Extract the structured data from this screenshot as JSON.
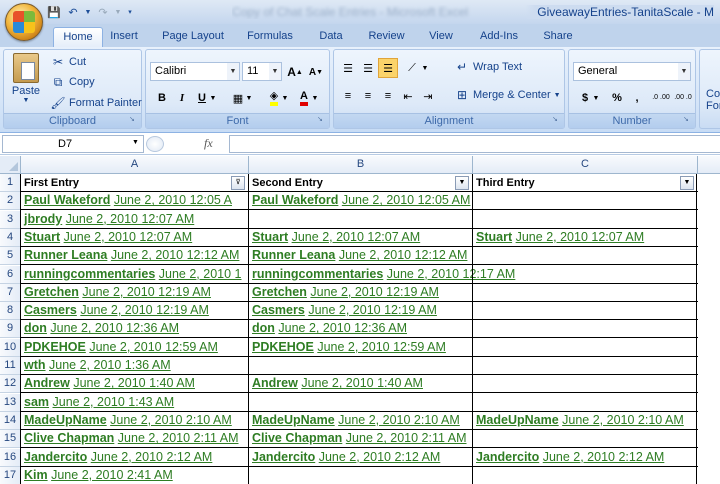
{
  "titlebar": {
    "title": "GiveawayEntries-TanitaScale - M",
    "blurred": "Copy of Chat Scale Entries - Microsoft Excel"
  },
  "tabs": [
    "Home",
    "Insert",
    "Page Layout",
    "Formulas",
    "Data",
    "Review",
    "View",
    "Add-Ins",
    "Share"
  ],
  "ribbon": {
    "clipboard": {
      "label": "Clipboard",
      "paste": "Paste",
      "cut": "Cut",
      "copy": "Copy",
      "format_painter": "Format Painter"
    },
    "font": {
      "label": "Font",
      "name": "Calibri",
      "size": "11",
      "bold": "B",
      "italic": "I",
      "underline": "U",
      "grow": "A",
      "shrink": "A",
      "font_color": "A"
    },
    "alignment": {
      "label": "Alignment",
      "wrap_text": "Wrap Text",
      "merge_center": "Merge & Center"
    },
    "number": {
      "label": "Number",
      "format": "General",
      "currency": "$",
      "percent": "%",
      "comma": ",",
      "inc_decimal": ".0 .00",
      "dec_decimal": ".00 .0"
    },
    "conditional": {
      "line1": "Co",
      "line2": "For"
    }
  },
  "formula_bar": {
    "name_box": "D7",
    "fx": "fx",
    "formula": ""
  },
  "columns": [
    "A",
    "B",
    "C"
  ],
  "header_row": {
    "a": "First Entry",
    "b": "Second Entry",
    "c": "Third Entry"
  },
  "rows": [
    {
      "num": "2",
      "a": {
        "name": "Paul Wakeford",
        "date": "June 2, 2010 12:05 A"
      },
      "b": {
        "name": "Paul Wakeford",
        "date": "June 2, 2010 12:05 AM"
      },
      "c": null
    },
    {
      "num": "3",
      "a": {
        "name": "jbrody",
        "date": "June 2, 2010 12:07 AM"
      },
      "b": null,
      "c": null
    },
    {
      "num": "4",
      "a": {
        "name": "Stuart",
        "date": "June 2, 2010 12:07 AM"
      },
      "b": {
        "name": "Stuart",
        "date": "June 2, 2010 12:07 AM"
      },
      "c": {
        "name": "Stuart",
        "date": "June 2, 2010 12:07 AM"
      }
    },
    {
      "num": "5",
      "a": {
        "name": "Runner Leana",
        "date": "June 2, 2010 12:12 AM"
      },
      "b": {
        "name": "Runner Leana",
        "date": "June 2, 2010 12:12 AM"
      },
      "c": null
    },
    {
      "num": "6",
      "a": {
        "name": "runningcommentaries",
        "date": "June 2, 2010 1"
      },
      "b": {
        "name": "runningcommentaries",
        "date": "June 2, 2010 12:17 AM"
      },
      "c": null
    },
    {
      "num": "7",
      "a": {
        "name": "Gretchen",
        "date": "June 2, 2010 12:19 AM"
      },
      "b": {
        "name": "Gretchen",
        "date": "June 2, 2010 12:19 AM"
      },
      "c": null
    },
    {
      "num": "8",
      "a": {
        "name": "Casmers",
        "date": "June 2, 2010 12:19 AM"
      },
      "b": {
        "name": "Casmers",
        "date": "June 2, 2010 12:19 AM"
      },
      "c": null
    },
    {
      "num": "9",
      "a": {
        "name": "don",
        "date": "June 2, 2010 12:36 AM"
      },
      "b": {
        "name": "don",
        "date": "June 2, 2010 12:36 AM"
      },
      "c": null
    },
    {
      "num": "10",
      "a": {
        "name": "PDKEHOE",
        "date": "June 2, 2010 12:59 AM"
      },
      "b": {
        "name": "PDKEHOE",
        "date": "June 2, 2010 12:59 AM"
      },
      "c": null
    },
    {
      "num": "11",
      "a": {
        "name": "wth",
        "date": "June 2, 2010 1:36 AM"
      },
      "b": null,
      "c": null
    },
    {
      "num": "12",
      "a": {
        "name": "Andrew",
        "date": "June 2, 2010 1:40 AM"
      },
      "b": {
        "name": "Andrew",
        "date": "June 2, 2010 1:40 AM"
      },
      "c": null
    },
    {
      "num": "13",
      "a": {
        "name": "sam",
        "date": "June 2, 2010 1:43 AM"
      },
      "b": null,
      "c": null
    },
    {
      "num": "14",
      "a": {
        "name": "MadeUpName",
        "date": "June 2, 2010 2:10 AM"
      },
      "b": {
        "name": "MadeUpName",
        "date": "June 2, 2010 2:10 AM"
      },
      "c": {
        "name": "MadeUpName",
        "date": "June 2, 2010 2:10 AM"
      }
    },
    {
      "num": "15",
      "a": {
        "name": "Clive Chapman",
        "date": "June 2, 2010 2:11 AM"
      },
      "b": {
        "name": "Clive Chapman",
        "date": "June 2, 2010 2:11 AM"
      },
      "c": null
    },
    {
      "num": "16",
      "a": {
        "name": "Jandercito",
        "date": "June 2, 2010 2:12 AM"
      },
      "b": {
        "name": "Jandercito",
        "date": "June 2, 2010 2:12 AM"
      },
      "c": {
        "name": "Jandercito",
        "date": "June 2, 2010 2:12 AM"
      }
    },
    {
      "num": "17",
      "a": {
        "name": "Kim",
        "date": "June 2, 2010 2:41 AM"
      },
      "b": null,
      "c": null
    }
  ],
  "colors": {
    "link_green": "#2e7d23",
    "ribbon_blue": "#15428b"
  }
}
